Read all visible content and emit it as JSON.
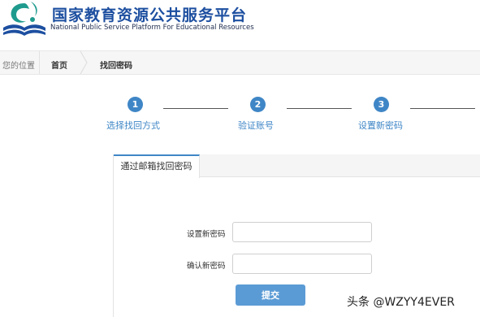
{
  "header": {
    "brand_cn": "国家教育资源公共服务平台",
    "brand_en": "National Public Service Platform For Educational Resources",
    "logo_icon": "edu-platform-logo-icon",
    "colors": {
      "brand_blue": "#1d4fa0",
      "logo_green": "#1f9b8e"
    }
  },
  "breadcrumb": {
    "location_label": "您的位置",
    "home": "首页",
    "current": "找回密码"
  },
  "steps": [
    {
      "number": "1",
      "label": "选择找回方式"
    },
    {
      "number": "2",
      "label": "验证账号"
    },
    {
      "number": "3",
      "label": "设置新密码"
    }
  ],
  "panel": {
    "tab_label": "通过邮箱找回密码",
    "new_password_label": "设置新密码",
    "new_password_value": "",
    "confirm_password_label": "确认新密码",
    "confirm_password_value": "",
    "submit_label": "提交"
  },
  "watermark": "头条 @WZYY4EVER",
  "colors": {
    "accent": "#3f86c6",
    "button": "#5b9bd5"
  }
}
